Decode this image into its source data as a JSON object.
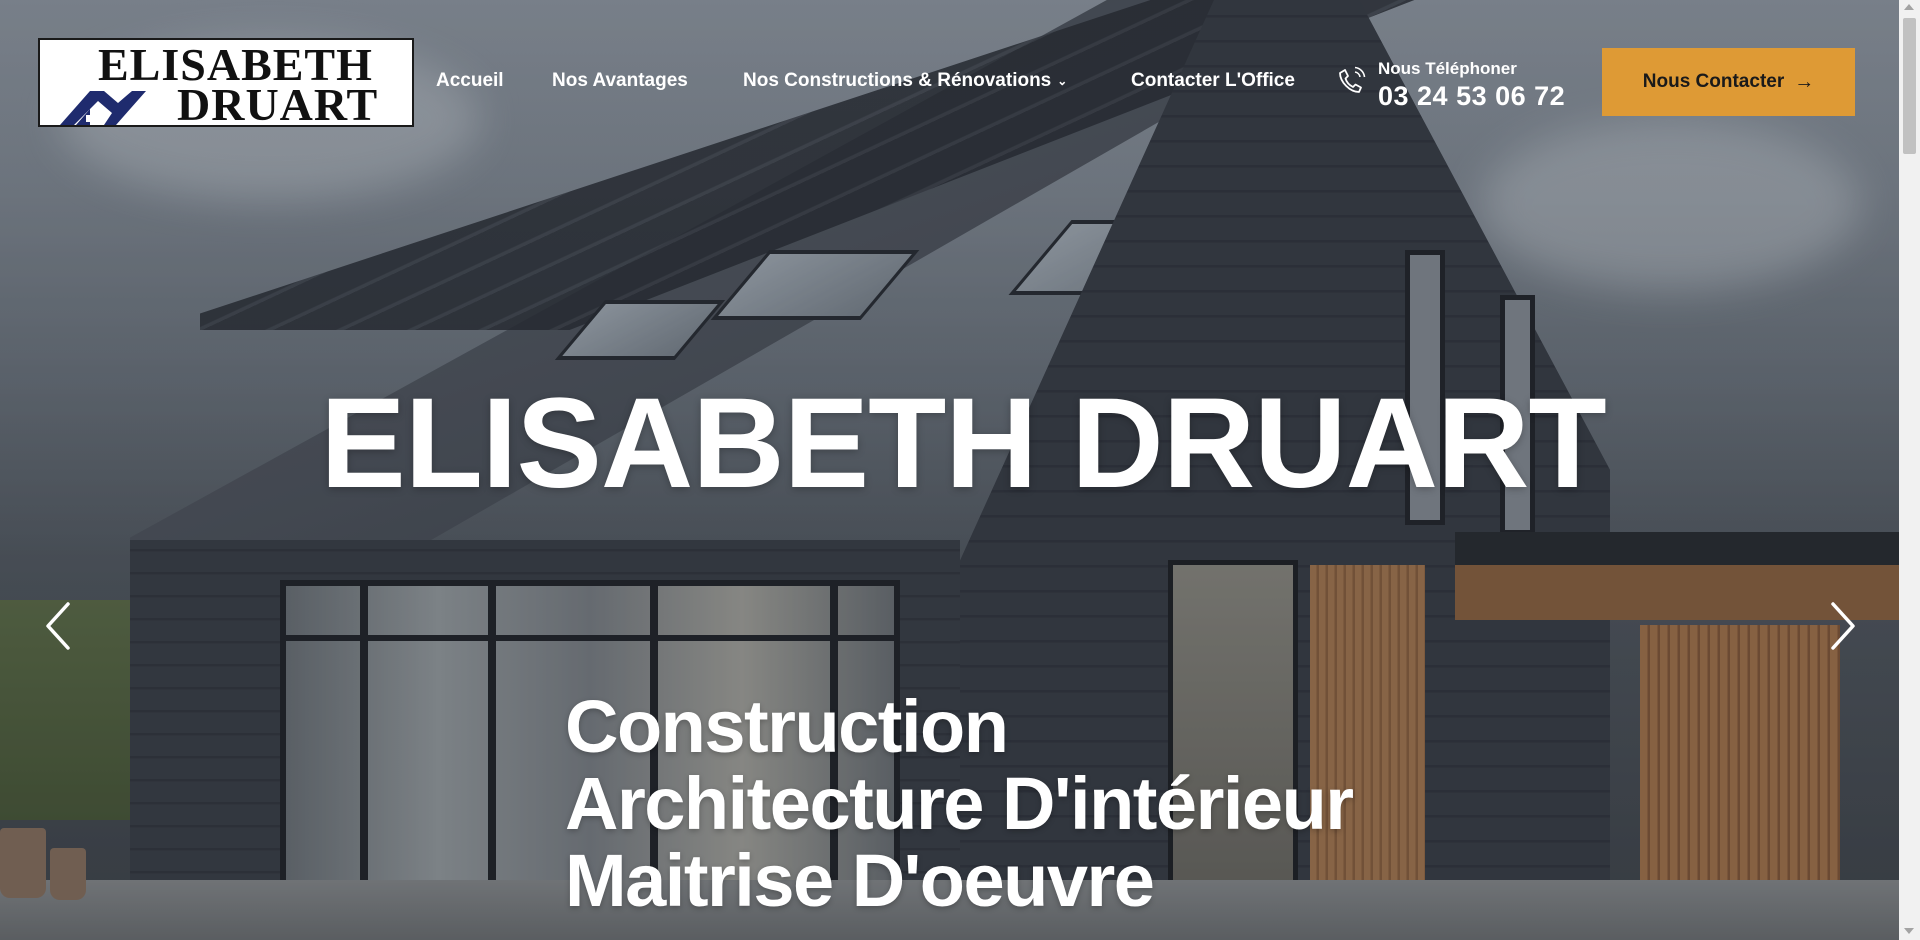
{
  "logo": {
    "line1": "ELISABETH",
    "line2": "DRUART"
  },
  "nav": {
    "items": [
      {
        "label": "Accueil"
      },
      {
        "label": "Nos Avantages"
      },
      {
        "label": "Nos Constructions & Rénovations",
        "has_dropdown": true
      },
      {
        "label": "Contacter L'Office"
      }
    ]
  },
  "phone": {
    "label": "Nous Téléphoner",
    "number": "03 24 53 06 72",
    "icon": "phone-ringing-icon"
  },
  "cta": {
    "label": "Nous Contacter",
    "icon": "arrow-right-icon"
  },
  "hero": {
    "title": "ELISABETH DRUART",
    "lines": [
      "Construction",
      "Architecture D'intérieur",
      "Maitrise D'oeuvre"
    ],
    "prev_icon": "chevron-left-icon",
    "next_icon": "chevron-right-icon"
  },
  "colors": {
    "accent": "#de9a35",
    "text": "#ffffff",
    "cta_text": "#1a1a1a"
  }
}
